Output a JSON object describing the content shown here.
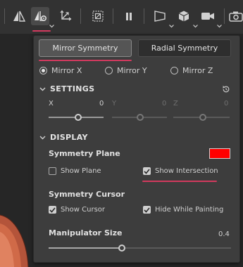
{
  "toolbar": {
    "icons": [
      "mirror-icon",
      "symmetry-settings-icon",
      "transform-icon",
      "snap-grid-icon",
      "pause-icon",
      "perspective-icon",
      "cube-icon",
      "camera-icon",
      "screenshot-icon"
    ]
  },
  "panel": {
    "tabs": [
      {
        "label": "Mirror Symmetry",
        "selected": true
      },
      {
        "label": "Radial Symmetry",
        "selected": false
      }
    ],
    "mirror_axes": [
      {
        "label": "Mirror X",
        "selected": true
      },
      {
        "label": "Mirror Y",
        "selected": false
      },
      {
        "label": "Mirror Z",
        "selected": false
      }
    ],
    "settings": {
      "title": "SETTINGS",
      "axes": [
        {
          "label": "X",
          "value": "0",
          "enabled": true
        },
        {
          "label": "Y",
          "value": "0",
          "enabled": false
        },
        {
          "label": "Z",
          "value": "0",
          "enabled": false
        }
      ]
    },
    "display": {
      "title": "DISPLAY",
      "symmetry_plane_label": "Symmetry Plane",
      "plane_color": "#ff0000",
      "show_plane": {
        "label": "Show Plane",
        "checked": false
      },
      "show_intersection": {
        "label": "Show Intersection",
        "checked": true
      },
      "symmetry_cursor_label": "Symmetry Cursor",
      "show_cursor": {
        "label": "Show Cursor",
        "checked": true
      },
      "hide_while_painting": {
        "label": "Hide While Painting",
        "checked": true
      },
      "manipulator_size_label": "Manipulator Size",
      "manipulator_size_value": "0.4",
      "manipulator_size_fraction": 0.4
    }
  },
  "colors": {
    "accent_underline": "#d23a5e",
    "plane_swatch": "#ff0000"
  }
}
